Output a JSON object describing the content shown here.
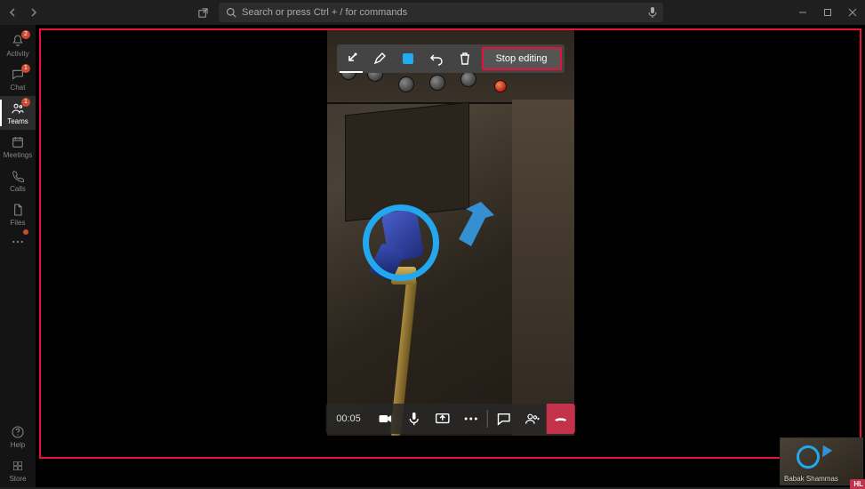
{
  "titlebar": {
    "search_placeholder": "Search or press Ctrl + / for commands"
  },
  "rail": {
    "items": [
      {
        "label": "Activity",
        "badge": "2"
      },
      {
        "label": "Chat",
        "badge": "1"
      },
      {
        "label": "Teams",
        "badge": "1"
      },
      {
        "label": "Meetings",
        "badge": ""
      },
      {
        "label": "Calls",
        "badge": ""
      },
      {
        "label": "Files",
        "badge": ""
      }
    ],
    "help": "Help",
    "store": "Store"
  },
  "editing": {
    "stop_label": "Stop editing",
    "tools": {
      "arrow": "arrow-tool",
      "pen": "pen-tool",
      "color": "color-swatch",
      "undo": "undo",
      "delete": "delete"
    },
    "swatch_color": "#22abee"
  },
  "call": {
    "timer": "00:05"
  },
  "pip": {
    "name": "Babak Shammas",
    "badge": "HL"
  },
  "annotation": {
    "circle_color": "#23a7ee",
    "arrow_color": "#3590d1"
  }
}
